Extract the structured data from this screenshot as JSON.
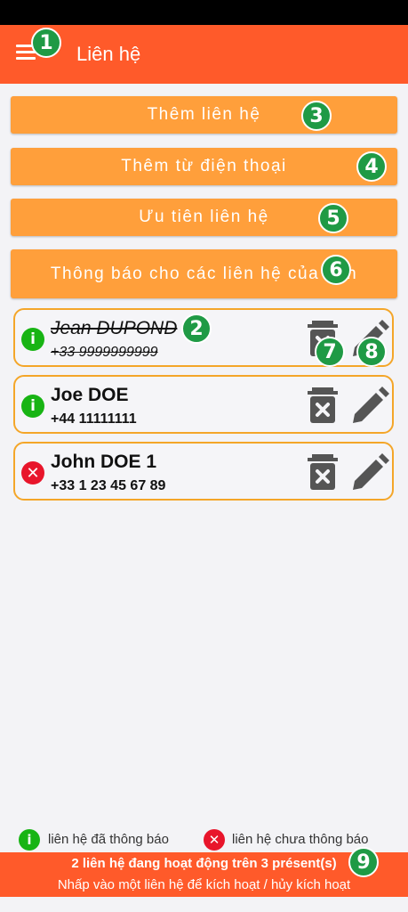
{
  "app_bar": {
    "title": "Liên hệ",
    "menu_icon": "hamburger-menu-icon"
  },
  "actions": [
    {
      "label": "Thêm liên hệ"
    },
    {
      "label": "Thêm từ điện thoại"
    },
    {
      "label": "Ưu tiên liên hệ"
    },
    {
      "label": "Thông báo cho các liên hệ của bạn"
    }
  ],
  "contacts": [
    {
      "name": "Jean DUPOND",
      "phone": "+33 9999999999",
      "status": "notified",
      "active": false
    },
    {
      "name": "Joe DOE",
      "phone": "+44 11111111",
      "status": "notified",
      "active": true
    },
    {
      "name": "John DOE 1",
      "phone": "+33 1 23 45 67 89",
      "status": "not_notified",
      "active": true
    }
  ],
  "legend": {
    "notified_label": "liên hệ đã thông báo",
    "not_notified_label": "liên hệ chưa thông báo"
  },
  "footer": {
    "summary": "2 liên hệ đang hoạt động trên 3 présent(s)",
    "hint": "Nhấp vào một liên hệ để kích hoạt / hủy kích hoạt"
  },
  "annotations": [
    "1",
    "2",
    "3",
    "4",
    "5",
    "6",
    "7",
    "8",
    "9"
  ],
  "icons": {
    "notified": "info-icon",
    "not_notified": "cross-icon",
    "delete": "trash-icon",
    "edit": "pencil-icon"
  },
  "colors": {
    "app_bar": "#ff5a2a",
    "button": "#ff9f3b",
    "card_border": "#f4a629",
    "notified": "#18b414",
    "not_notified": "#e8152b",
    "annotation_badge": "#1f9a45"
  }
}
